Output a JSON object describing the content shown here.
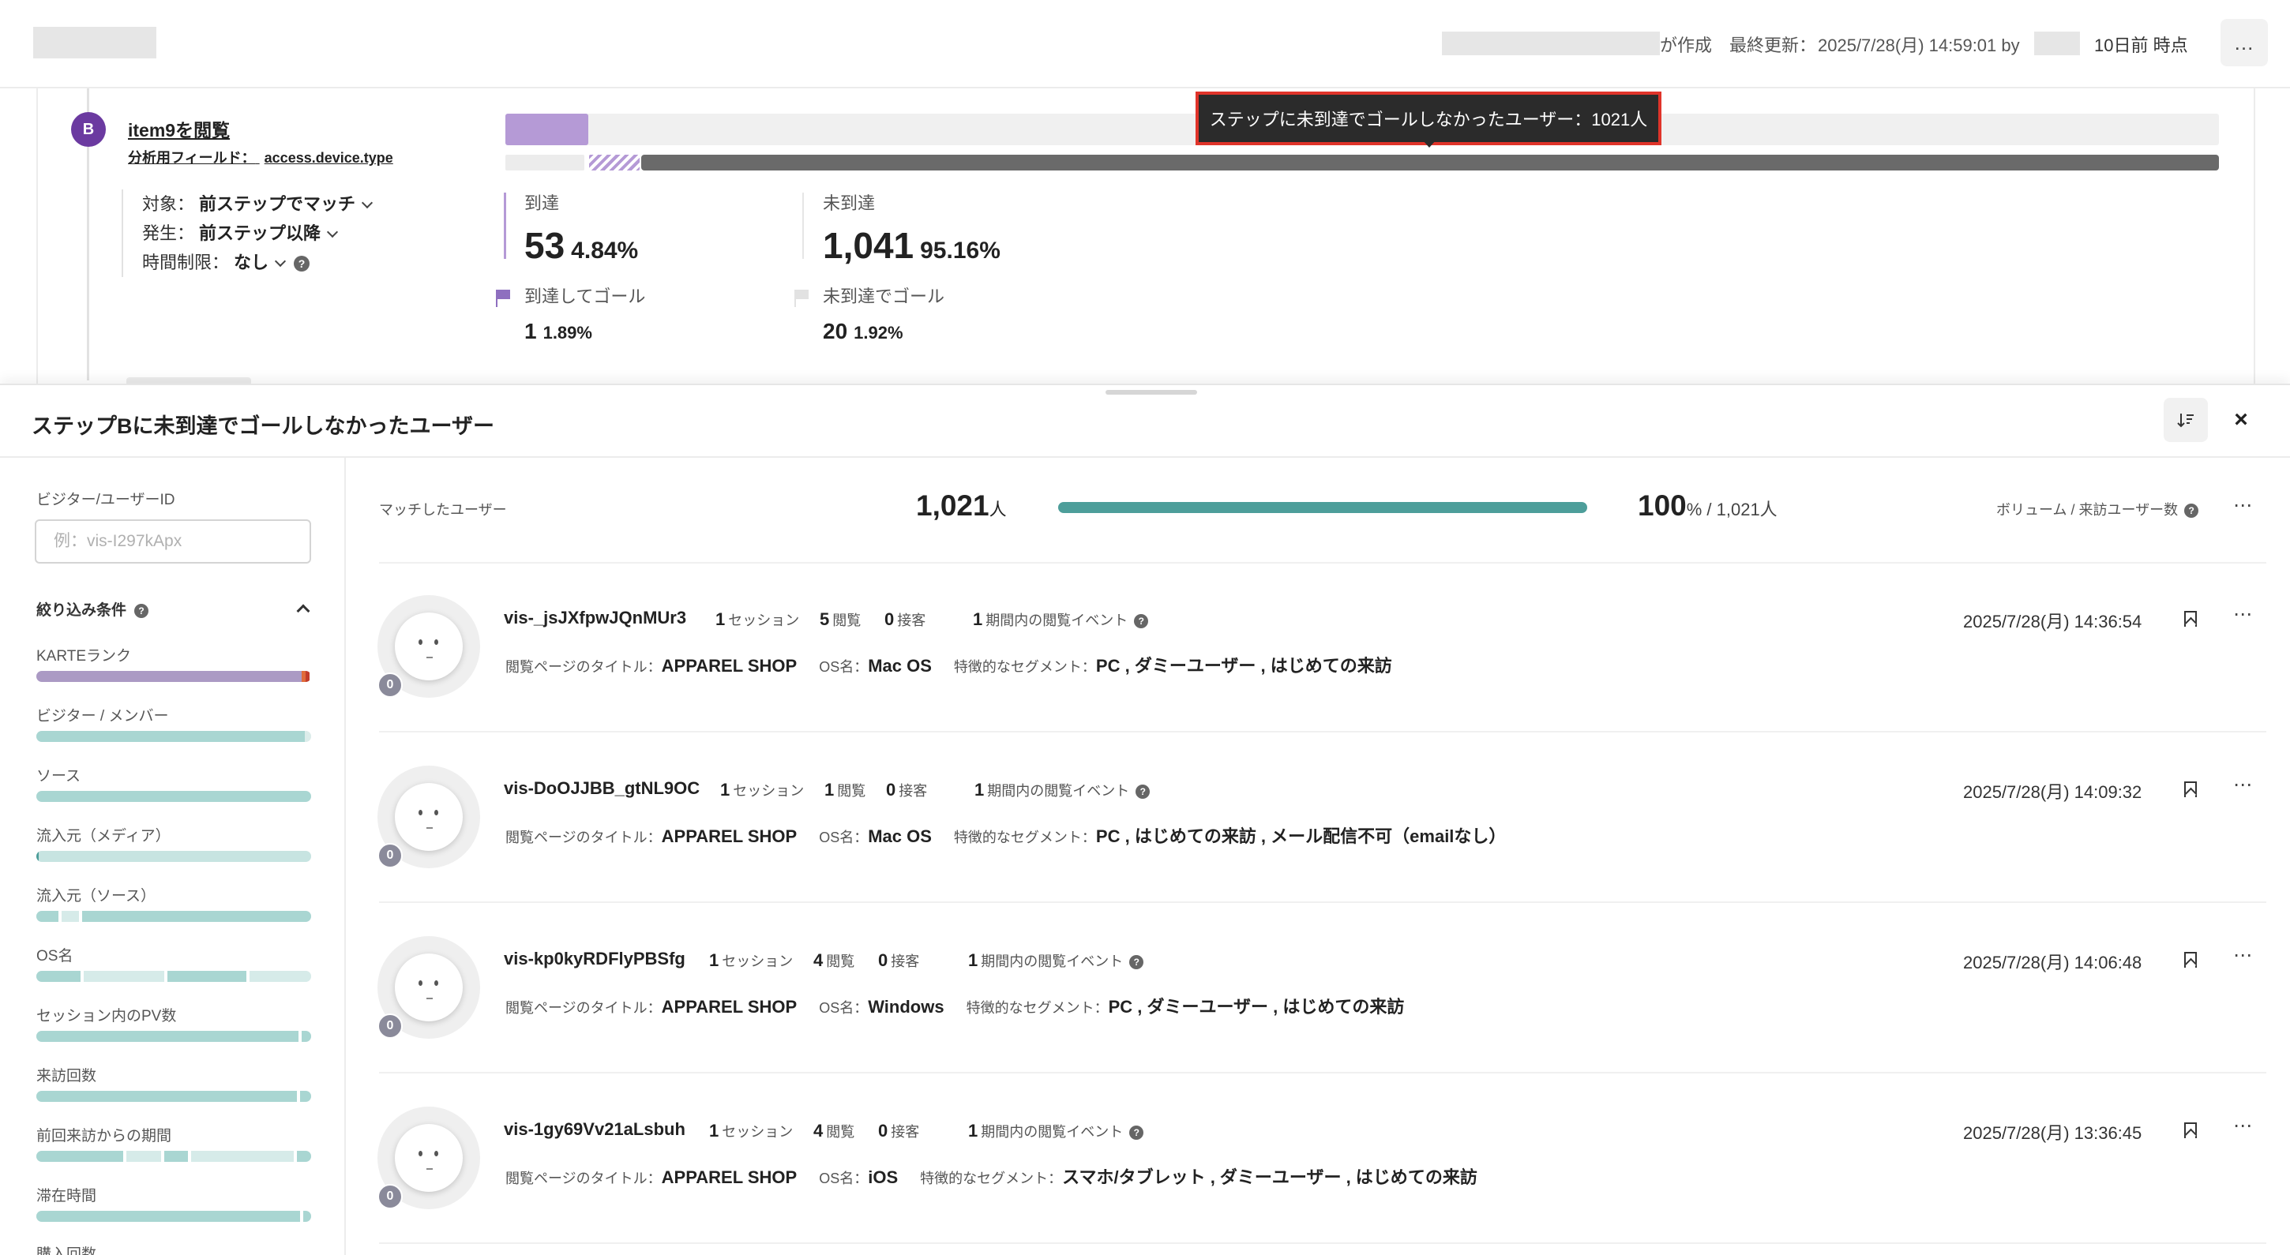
{
  "header": {
    "created_suffix": "が作成",
    "last_updated_label": "最終更新：",
    "last_updated_value": "2025/7/28(月) 14:59:01 by",
    "as_of": "10日前 時点",
    "menu_icon": "…"
  },
  "step": {
    "badge": "B",
    "title": "item9を閲覧",
    "field_label": "分析用フィールド：",
    "field_value": "access.device.type",
    "options": [
      {
        "label": "対象：",
        "value": "前ステップでマッチ"
      },
      {
        "label": "発生：",
        "value": "前ステップ以降"
      },
      {
        "label": "時間制限：",
        "value": "なし"
      }
    ],
    "reached_fraction": 0.0484,
    "tooltip": "ステップに未到達でゴールしなかったユーザー：1021人",
    "reached": {
      "label": "到達",
      "count": "53",
      "pct": "4.84%"
    },
    "not_reached": {
      "label": "未到達",
      "count": "1,041",
      "pct": "95.16%"
    },
    "reached_goal": {
      "label": "到達してゴール",
      "count": "1",
      "pct": "1.89%"
    },
    "not_reached_goal": {
      "label": "未到達でゴール",
      "count": "20",
      "pct": "1.92%"
    }
  },
  "drawer": {
    "title": "ステップBに未到達でゴールしなかったユーザー",
    "sort_icon": "sort-descending-icon",
    "close": "×"
  },
  "sidebar": {
    "id_label": "ビジター/ユーザーID",
    "id_placeholder": "例：vis-I297kApx",
    "filter_title": "絞り込み条件",
    "filters": [
      {
        "label": "KARTEランク"
      },
      {
        "label": "ビジター / メンバー"
      },
      {
        "label": "ソース"
      },
      {
        "label": "流入元（メディア）"
      },
      {
        "label": "流入元（ソース）"
      },
      {
        "label": "OS名"
      },
      {
        "label": "セッション内のPV数"
      },
      {
        "label": "来訪回数"
      },
      {
        "label": "前回来訪からの期間"
      },
      {
        "label": "滞在時間"
      },
      {
        "label": "購入回数"
      }
    ]
  },
  "summary": {
    "matched_label": "マッチしたユーザー",
    "matched_count": "1,021",
    "unit": "人",
    "pct": "100",
    "pct_suffix": "% / 1,021人",
    "fill_fraction": 1.0,
    "volume_label": "ボリューム / 来訪ユーザー数"
  },
  "labels": {
    "session": "セッション",
    "pageview": "閲覧",
    "contact": "接客",
    "period_events": "期間内の閲覧イベント",
    "page_title": "閲覧ページのタイトル：",
    "os": "OS名：",
    "segment": "特徴的なセグメント："
  },
  "users": [
    {
      "id": "vis-_jsJXfpwJQnMUr3",
      "sessions": "1",
      "views": "5",
      "contacts": "0",
      "events": "1",
      "page_title": "APPAREL SHOP",
      "os": "Mac OS",
      "segments": "PC , ダミーユーザー , はじめての来訪",
      "date": "2025/7/28(月) 14:36:54",
      "badge": "0"
    },
    {
      "id": "vis-DoOJJBB_gtNL9OC",
      "sessions": "1",
      "views": "1",
      "contacts": "0",
      "events": "1",
      "page_title": "APPAREL SHOP",
      "os": "Mac OS",
      "segments": "PC , はじめての来訪 , メール配信不可（emailなし）",
      "date": "2025/7/28(月) 14:09:32",
      "badge": "0"
    },
    {
      "id": "vis-kp0kyRDFlyPBSfg",
      "sessions": "1",
      "views": "4",
      "contacts": "0",
      "events": "1",
      "page_title": "APPAREL SHOP",
      "os": "Windows",
      "segments": "PC , ダミーユーザー , はじめての来訪",
      "date": "2025/7/28(月) 14:06:48",
      "badge": "0"
    },
    {
      "id": "vis-1gy69Vv21aLsbuh",
      "sessions": "1",
      "views": "4",
      "contacts": "0",
      "events": "1",
      "page_title": "APPAREL SHOP",
      "os": "iOS",
      "segments": "スマホ/タブレット , ダミーユーザー , はじめての来訪",
      "date": "2025/7/28(月) 13:36:45",
      "badge": "0"
    }
  ],
  "colors": {
    "accent_purple": "#6b3aa0",
    "reached_purple": "#b59ad6",
    "teal": "#4d9e9a",
    "light_teal": "#a9d6d2",
    "highlight_red": "#e0342a"
  }
}
